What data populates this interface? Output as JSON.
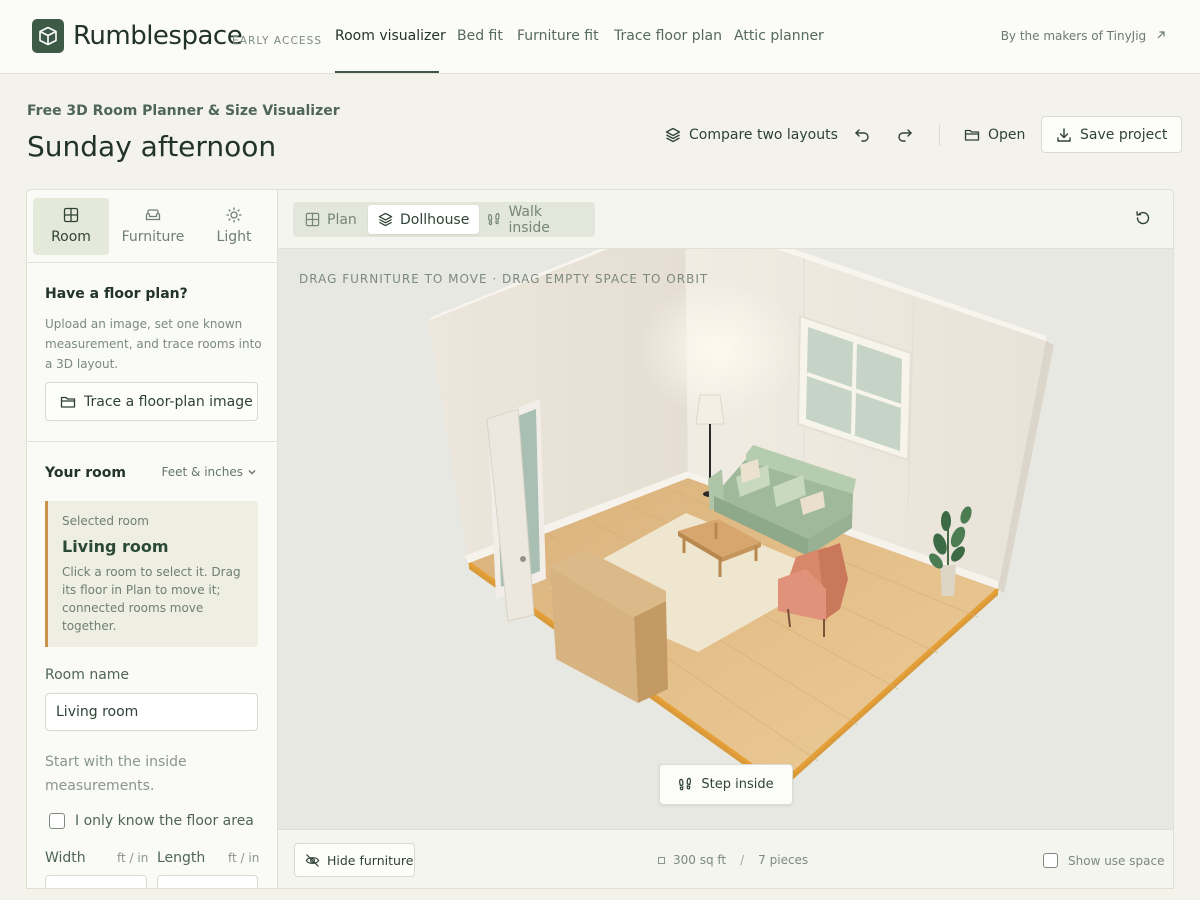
{
  "nav": {
    "brand": "Rumblespace",
    "badge": "EARLY ACCESS",
    "items": [
      {
        "label": "Room visualizer",
        "active": true
      },
      {
        "label": "Bed fit"
      },
      {
        "label": "Furniture fit"
      },
      {
        "label": "Trace floor plan"
      },
      {
        "label": "Attic planner"
      }
    ],
    "makers": "By the makers of TinyJig"
  },
  "header": {
    "subtitle": "Free 3D Room Planner & Size Visualizer",
    "title": "Sunday afternoon",
    "compare": "Compare two layouts",
    "open": "Open",
    "save": "Save project"
  },
  "panel": {
    "tabs": [
      {
        "label": "Room",
        "icon": "grid-icon",
        "active": true
      },
      {
        "label": "Furniture",
        "icon": "sofa-icon"
      },
      {
        "label": "Light",
        "icon": "sun-icon"
      }
    ],
    "floorplan": {
      "heading": "Have a floor plan?",
      "text": "Upload an image, set one known measurement, and trace rooms into a 3D layout.",
      "button": "Trace a floor-plan image"
    },
    "room": {
      "heading": "Your room",
      "units": "Feet & inches",
      "selected_label": "Selected room",
      "selected_name": "Living room",
      "selected_desc": "Click a room to select it. Drag its floor in Plan to move it; connected rooms move together.",
      "name_label": "Room name",
      "name_value": "Living room",
      "inside_text": "Start with the inside measurements.",
      "area_only": "I only know the floor area",
      "width_label": "Width",
      "width_unit": "ft / in",
      "length_label": "Length",
      "length_unit": "ft / in"
    }
  },
  "viewer": {
    "modes": [
      {
        "label": "Plan",
        "icon": "grid-icon"
      },
      {
        "label": "Dollhouse",
        "icon": "layers-icon",
        "active": true
      },
      {
        "label": "Walk inside",
        "icon": "footprints-icon"
      }
    ],
    "hint": "DRAG FURNITURE TO MOVE · DRAG EMPTY SPACE TO ORBIT",
    "step_inside": "Step inside",
    "hide_furniture": "Hide furniture",
    "area": "300 sq ft",
    "separator": "/",
    "pieces": "7 pieces",
    "show_use_space": "Show use space"
  },
  "colors": {
    "accent": "#3d5a47",
    "floor": "#e2b97c",
    "sofa": "#a6c2a0",
    "chair": "#d98a66",
    "selected_bar": "#c9924e"
  }
}
